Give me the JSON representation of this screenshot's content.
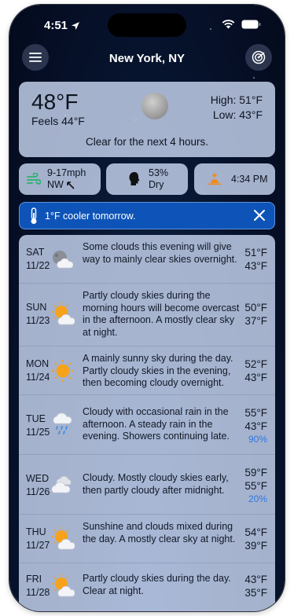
{
  "status_bar": {
    "time": "4:51"
  },
  "header": {
    "location": "New York, NY"
  },
  "current": {
    "temp": "48°F",
    "feels": "Feels 44°F",
    "high": "High: 51°F",
    "low": "Low: 43°F",
    "summary": "Clear for the next 4 hours."
  },
  "details": {
    "wind_speed": "9-17mph",
    "wind_dir": "NW",
    "humidity": "53%",
    "humidity_label": "Dry",
    "sunset": "4:34 PM"
  },
  "alert": {
    "message": "1°F cooler tomorrow."
  },
  "forecast": [
    {
      "day": "SAT",
      "date": "11/22",
      "icon": "partly-cloudy-night-icon",
      "desc": "Some clouds this evening will give way to mainly clear skies overnight.",
      "high": "51°F",
      "low": "43°F",
      "pop": ""
    },
    {
      "day": "SUN",
      "date": "11/23",
      "icon": "partly-cloudy-day-icon",
      "desc": "Partly cloudy skies during the morning hours will become overcast in the afternoon. A mostly clear sky at night.",
      "high": "50°F",
      "low": "37°F",
      "pop": ""
    },
    {
      "day": "MON",
      "date": "11/24",
      "icon": "sunny-icon",
      "desc": "A mainly sunny sky during the day. Partly cloudy skies in the evening, then becoming cloudy overnight.",
      "high": "52°F",
      "low": "43°F",
      "pop": ""
    },
    {
      "day": "TUE",
      "date": "11/25",
      "icon": "rain-icon",
      "desc": "Cloudy with occasional rain in the afternoon. A steady rain in the evening. Showers continuing late.",
      "high": "55°F",
      "low": "43°F",
      "pop": "90%"
    },
    {
      "day": "WED",
      "date": "11/26",
      "icon": "cloudy-icon",
      "desc": "Cloudy. Mostly cloudy skies early, then partly cloudy after midnight.",
      "high": "59°F",
      "low": "55°F",
      "pop": "20%"
    },
    {
      "day": "THU",
      "date": "11/27",
      "icon": "partly-cloudy-day-icon",
      "desc": "Sunshine and clouds mixed during the day. A mostly clear sky at night.",
      "high": "54°F",
      "low": "39°F",
      "pop": ""
    },
    {
      "day": "FRI",
      "date": "11/28",
      "icon": "partly-cloudy-day-icon",
      "desc": "Partly cloudy skies during the day. Clear at night.",
      "high": "43°F",
      "low": "35°F",
      "pop": ""
    }
  ]
}
